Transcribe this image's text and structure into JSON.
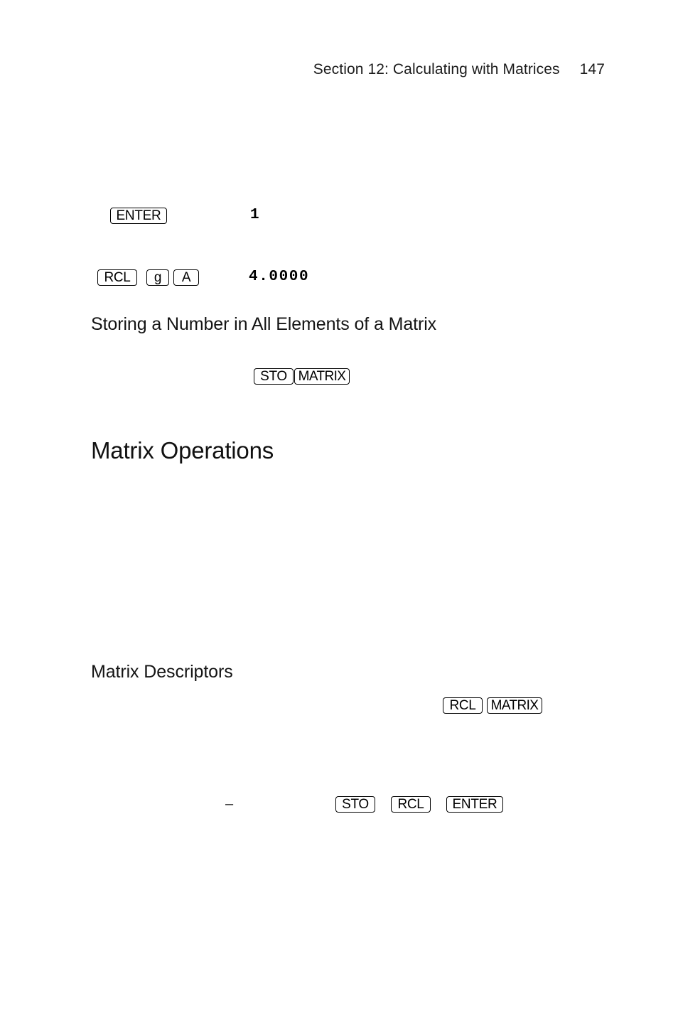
{
  "page": {
    "running_head": {
      "title": "Section 12: Calculating with Matrices",
      "page_number": "147"
    }
  },
  "headings": {
    "storing_number": "Storing a Number in All Elements of a Matrix",
    "matrix_operations": "Matrix Operations",
    "matrix_descriptors": "Matrix Descriptors"
  },
  "keystroke_rows": {
    "enter_row": {
      "keys": [
        {
          "label": "ENTER"
        }
      ],
      "display": "1"
    },
    "rcl_g_a_row": {
      "keys": [
        {
          "label": "RCL"
        },
        {
          "label": "g"
        },
        {
          "label": "A"
        }
      ],
      "display": "4.0000"
    },
    "sto_matrix_row": {
      "keys": [
        {
          "label": "STO"
        },
        {
          "label": "MATRIX"
        }
      ]
    },
    "rcl_matrix_row": {
      "keys": [
        {
          "label": "RCL"
        },
        {
          "label": "MATRIX"
        }
      ]
    },
    "sto_rcl_enter_row": {
      "dash": "–",
      "keys": [
        {
          "label": "STO"
        },
        {
          "label": "RCL"
        },
        {
          "label": "ENTER"
        }
      ]
    }
  }
}
